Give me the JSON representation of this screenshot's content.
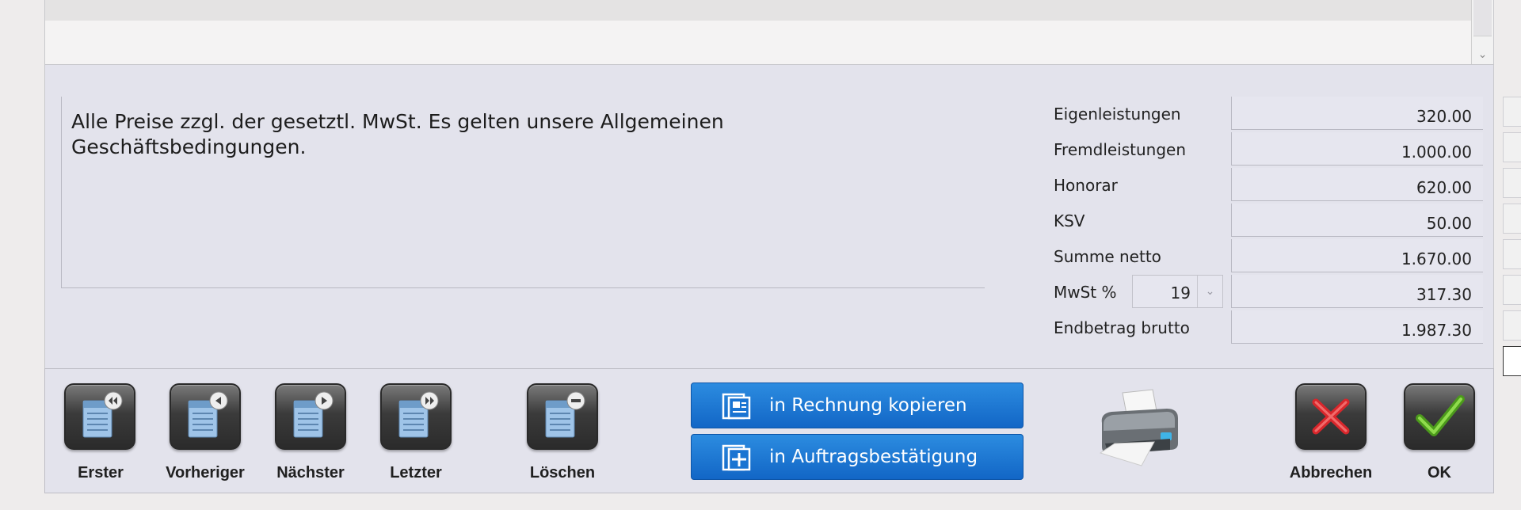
{
  "note": {
    "line1": "Alle Preise zzgl. der gesetztl. MwSt. Es gelten unsere Allgemeinen",
    "line2": "Geschäftsbedingungen."
  },
  "summary": {
    "rows": [
      {
        "label": "Eigenleistungen",
        "value": "320.00"
      },
      {
        "label": "Fremdleistungen",
        "value": "1.000.00"
      },
      {
        "label": "Honorar",
        "value": "620.00"
      },
      {
        "label": "KSV",
        "value": "50.00"
      },
      {
        "label": "Summe netto",
        "value": "1.670.00"
      },
      {
        "label": "MwSt %",
        "value": "317.30",
        "rate": "19"
      },
      {
        "label": "Endbetrag brutto",
        "value": "1.987.30"
      }
    ]
  },
  "toolbar": {
    "first_label": "Erster",
    "prev_label": "Vorheriger",
    "next_label": "Nächster",
    "last_label": "Letzter",
    "delete_label": "Löschen",
    "copy_invoice_label": "in Rechnung kopieren",
    "order_confirm_label": "in Auftragsbestätigung",
    "cancel_label": "Abbrechen",
    "ok_label": "OK"
  },
  "icons": {
    "first": "document-first-icon",
    "prev": "document-previous-icon",
    "next": "document-next-icon",
    "last": "document-last-icon",
    "delete": "document-delete-icon",
    "copy": "copy-document-icon",
    "add": "add-document-icon",
    "print": "printer-icon",
    "cancel": "red-x-icon",
    "ok": "green-check-icon"
  },
  "colors": {
    "accent_blue": "#1a74d2",
    "cancel_red": "#d8262b",
    "ok_green": "#5fb526"
  }
}
